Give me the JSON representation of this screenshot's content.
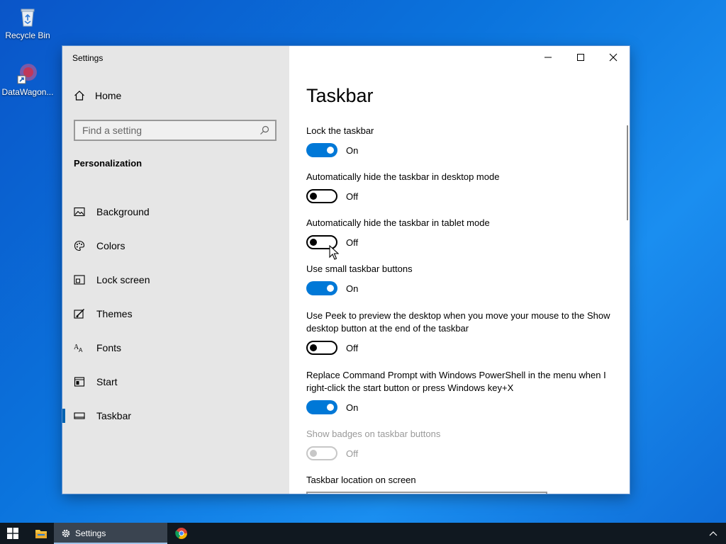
{
  "desktop": {
    "icons": [
      {
        "label": "Recycle Bin",
        "icon": "recycle-bin-icon"
      },
      {
        "label": "DataWagon...",
        "icon": "datawagon-shortcut-icon"
      }
    ]
  },
  "window": {
    "title": "Settings",
    "sidebar": {
      "home_label": "Home",
      "search_placeholder": "Find a setting",
      "section_heading": "Personalization",
      "items": [
        {
          "label": "Background",
          "icon": "image-icon"
        },
        {
          "label": "Colors",
          "icon": "palette-icon"
        },
        {
          "label": "Lock screen",
          "icon": "lock-screen-icon"
        },
        {
          "label": "Themes",
          "icon": "themes-brush-icon"
        },
        {
          "label": "Fonts",
          "icon": "fonts-icon"
        },
        {
          "label": "Start",
          "icon": "start-icon"
        },
        {
          "label": "Taskbar",
          "icon": "taskbar-icon",
          "selected": true
        }
      ]
    },
    "content": {
      "page_title": "Taskbar",
      "settings": [
        {
          "label": "Lock the taskbar",
          "state": "On"
        },
        {
          "label": "Automatically hide the taskbar in desktop mode",
          "state": "Off"
        },
        {
          "label": "Automatically hide the taskbar in tablet mode",
          "state": "Off"
        },
        {
          "label": "Use small taskbar buttons",
          "state": "On"
        },
        {
          "label": "Use Peek to preview the desktop when you move your mouse to the Show desktop button at the end of the taskbar",
          "state": "Off"
        },
        {
          "label": "Replace Command Prompt with Windows PowerShell in the menu when I right-click the start button or press Windows key+X",
          "state": "On"
        },
        {
          "label": "Show badges on taskbar buttons",
          "state": "Off",
          "disabled": true
        }
      ],
      "location_label": "Taskbar location on screen"
    }
  },
  "taskbar": {
    "active_app_label": "Settings"
  },
  "colors": {
    "accent": "#0078d7",
    "sidebar_bg": "#e6e6e6",
    "taskbar_bg": "#101820"
  }
}
